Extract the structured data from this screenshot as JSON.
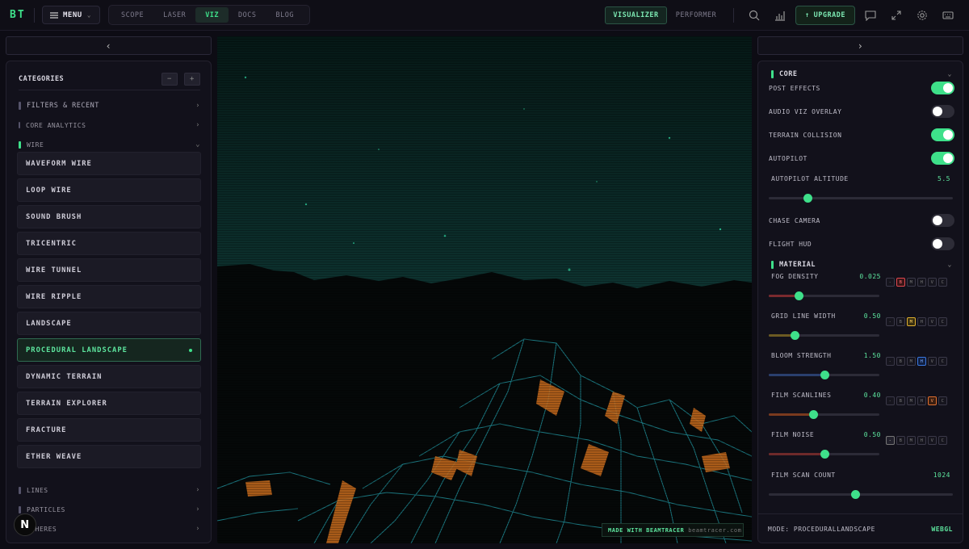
{
  "header": {
    "logo": "BT",
    "menu_label": "MENU",
    "nav_tabs": [
      {
        "label": "SCOPE",
        "active": false
      },
      {
        "label": "LASER",
        "active": false
      },
      {
        "label": "VIZ",
        "active": true
      },
      {
        "label": "DOCS",
        "active": false
      },
      {
        "label": "BLOG",
        "active": false
      }
    ],
    "mode_visualizer": "VISUALIZER",
    "mode_performer": "PERFORMER",
    "upgrade_label": "UPGRADE"
  },
  "sidebar": {
    "title": "CATEGORIES",
    "categories_top": [
      {
        "label": "FILTERS & RECENT"
      },
      {
        "label": "CORE ANALYTICS"
      }
    ],
    "expanded_category": "WIRE",
    "items": [
      {
        "label": "WAVEFORM WIRE",
        "active": false
      },
      {
        "label": "LOOP WIRE",
        "active": false
      },
      {
        "label": "SOUND BRUSH",
        "active": false
      },
      {
        "label": "TRICENTRIC",
        "active": false
      },
      {
        "label": "WIRE TUNNEL",
        "active": false
      },
      {
        "label": "WIRE RIPPLE",
        "active": false
      },
      {
        "label": "LANDSCAPE",
        "active": false
      },
      {
        "label": "PROCEDURAL LANDSCAPE",
        "active": true
      },
      {
        "label": "DYNAMIC TERRAIN",
        "active": false
      },
      {
        "label": "TERRAIN EXPLORER",
        "active": false
      },
      {
        "label": "FRACTURE",
        "active": false
      },
      {
        "label": "ETHER WEAVE",
        "active": false
      }
    ],
    "categories_bottom": [
      {
        "label": "LINES"
      },
      {
        "label": "PARTICLES"
      },
      {
        "label": "SPHERES"
      }
    ],
    "badge": "N"
  },
  "viewport": {
    "made_with": "MADE WITH BEAMTRACER",
    "site": "beamtracer.com"
  },
  "controls": {
    "core_title": "CORE",
    "toggles": [
      {
        "label": "POST EFFECTS",
        "on": true
      },
      {
        "label": "AUDIO VIZ OVERLAY",
        "on": false
      },
      {
        "label": "TERRAIN COLLISION",
        "on": true
      },
      {
        "label": "AUTOPILOT",
        "on": true
      }
    ],
    "autopilot_altitude": {
      "label": "AUTOPILOT ALTITUDE",
      "value": "5.5",
      "fraction": 0.21
    },
    "toggles2": [
      {
        "label": "CHASE CAMERA",
        "on": false
      },
      {
        "label": "FLIGHT HUD",
        "on": false
      }
    ],
    "material_title": "MATERIAL",
    "material_sliders": [
      {
        "label": "FOG DENSITY",
        "value": "0.025",
        "fraction": 0.27,
        "fill_color": "#7a2a2e",
        "mod_active": "B"
      },
      {
        "label": "GRID LINE WIDTH",
        "value": "0.50",
        "fraction": 0.23,
        "fill_color": "#6b5a22",
        "mod_active": "M"
      },
      {
        "label": "BLOOM STRENGTH",
        "value": "1.50",
        "fraction": 0.5,
        "fill_color": "#2a3f6e",
        "mod_active": "H"
      },
      {
        "label": "FILM SCANLINES",
        "value": "0.40",
        "fraction": 0.4,
        "fill_color": "#7a3a1e",
        "mod_active": "V"
      },
      {
        "label": "FILM NOISE",
        "value": "0.50",
        "fraction": 0.5,
        "fill_color": "#6e2a2a",
        "mod_active": "-"
      }
    ],
    "mod_letters": [
      "-",
      "B",
      "M",
      "H",
      "V",
      "C"
    ],
    "film_scan_count": {
      "label": "FILM SCAN COUNT",
      "value": "1024",
      "fraction": 0.47
    },
    "footer_mode": "MODE: PROCEDURALLANDSCAPE",
    "footer_renderer": "WEBGL"
  }
}
